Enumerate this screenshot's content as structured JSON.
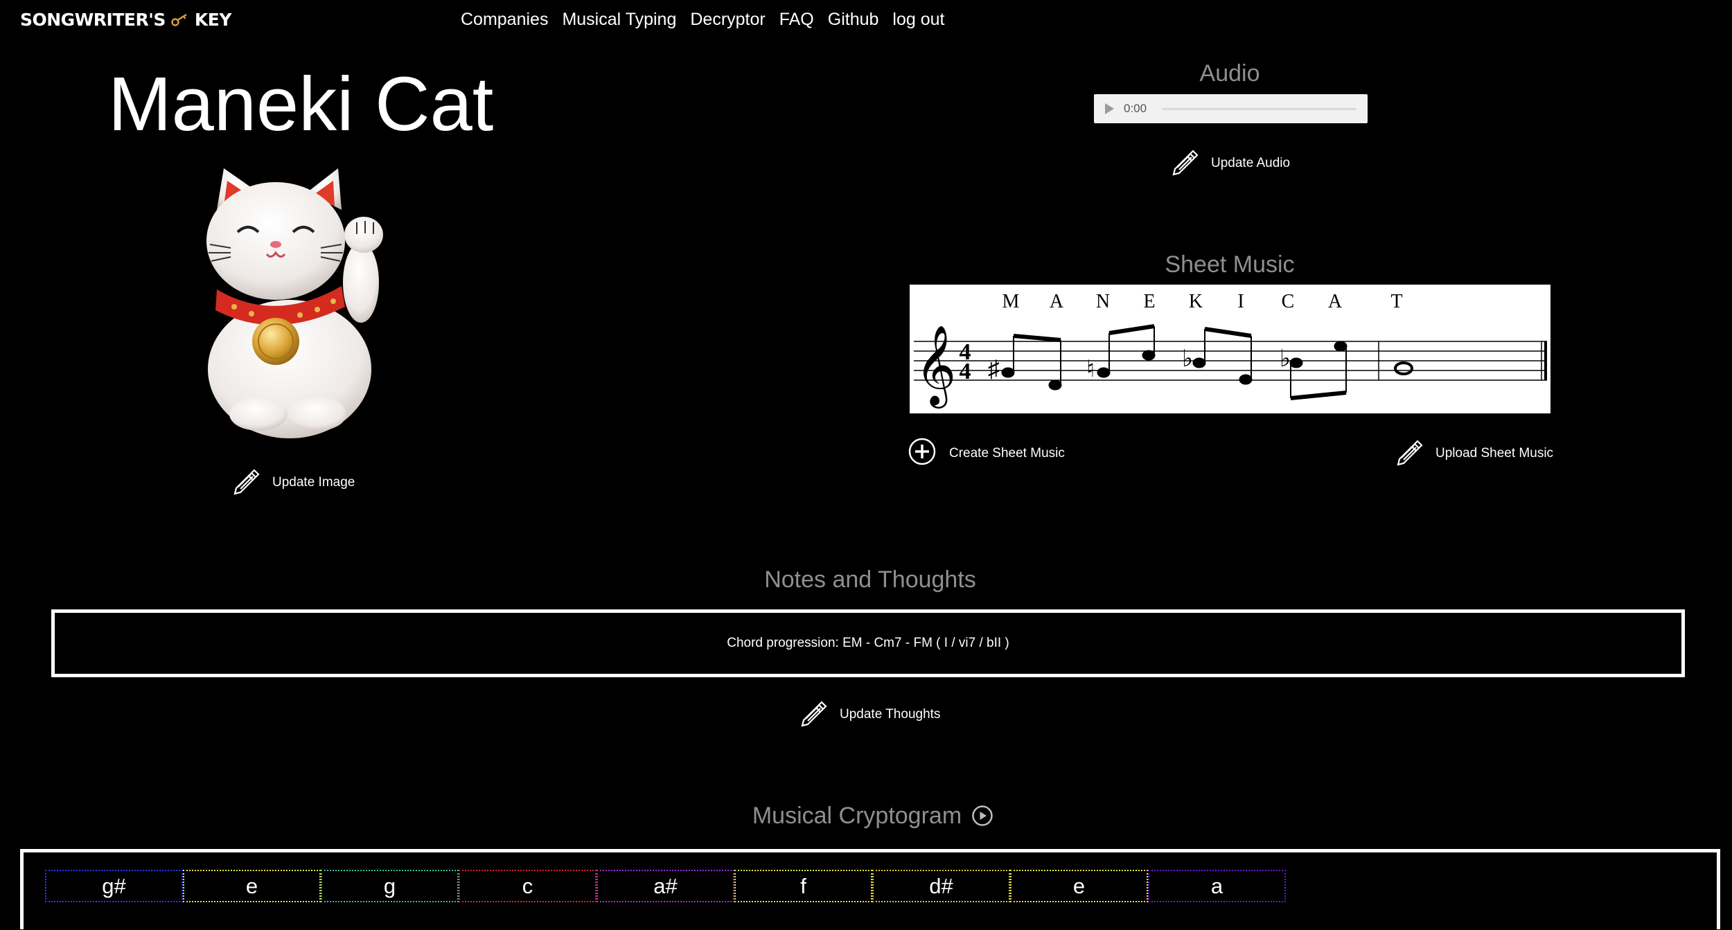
{
  "header": {
    "logo_left": "SONGWRITER'S",
    "logo_right": "KEY",
    "logo_icon": "key-icon",
    "nav": [
      "Companies",
      "Musical Typing",
      "Decryptor",
      "FAQ",
      "Github",
      "log out"
    ]
  },
  "song": {
    "title": "Maneki Cat",
    "image": "maneki-neko-cat",
    "update_image_label": "Update Image"
  },
  "audio": {
    "section_title": "Audio",
    "time": "0:00",
    "progress": 0,
    "update_label": "Update Audio"
  },
  "sheet_music": {
    "section_title": "Sheet Music",
    "letters": [
      "M",
      "A",
      "N",
      "E",
      "K",
      "I",
      "C",
      "A",
      "T"
    ],
    "time_signature": [
      "4",
      "4"
    ],
    "create_label": "Create Sheet Music",
    "upload_label": "Upload Sheet Music"
  },
  "notes": {
    "section_title": "Notes and Thoughts",
    "text": "Chord progression: EM - Cm7 - FM ( I / vi7 / bII )",
    "update_label": "Update Thoughts"
  },
  "cryptogram": {
    "section_title": "Musical Cryptogram",
    "cells": [
      {
        "note": "g#",
        "color": "#2a3cff"
      },
      {
        "note": "e",
        "color": "#e6e64a"
      },
      {
        "note": "g",
        "color": "#31c4a4"
      },
      {
        "note": "c",
        "color": "#e02b2b"
      },
      {
        "note": "a#",
        "color": "#a233e0"
      },
      {
        "note": "f",
        "color": "#e6e64a"
      },
      {
        "note": "d#",
        "color": "#e6c43a"
      },
      {
        "note": "e",
        "color": "#e6e64a"
      },
      {
        "note": "a",
        "color": "#6b1fd0"
      }
    ]
  }
}
